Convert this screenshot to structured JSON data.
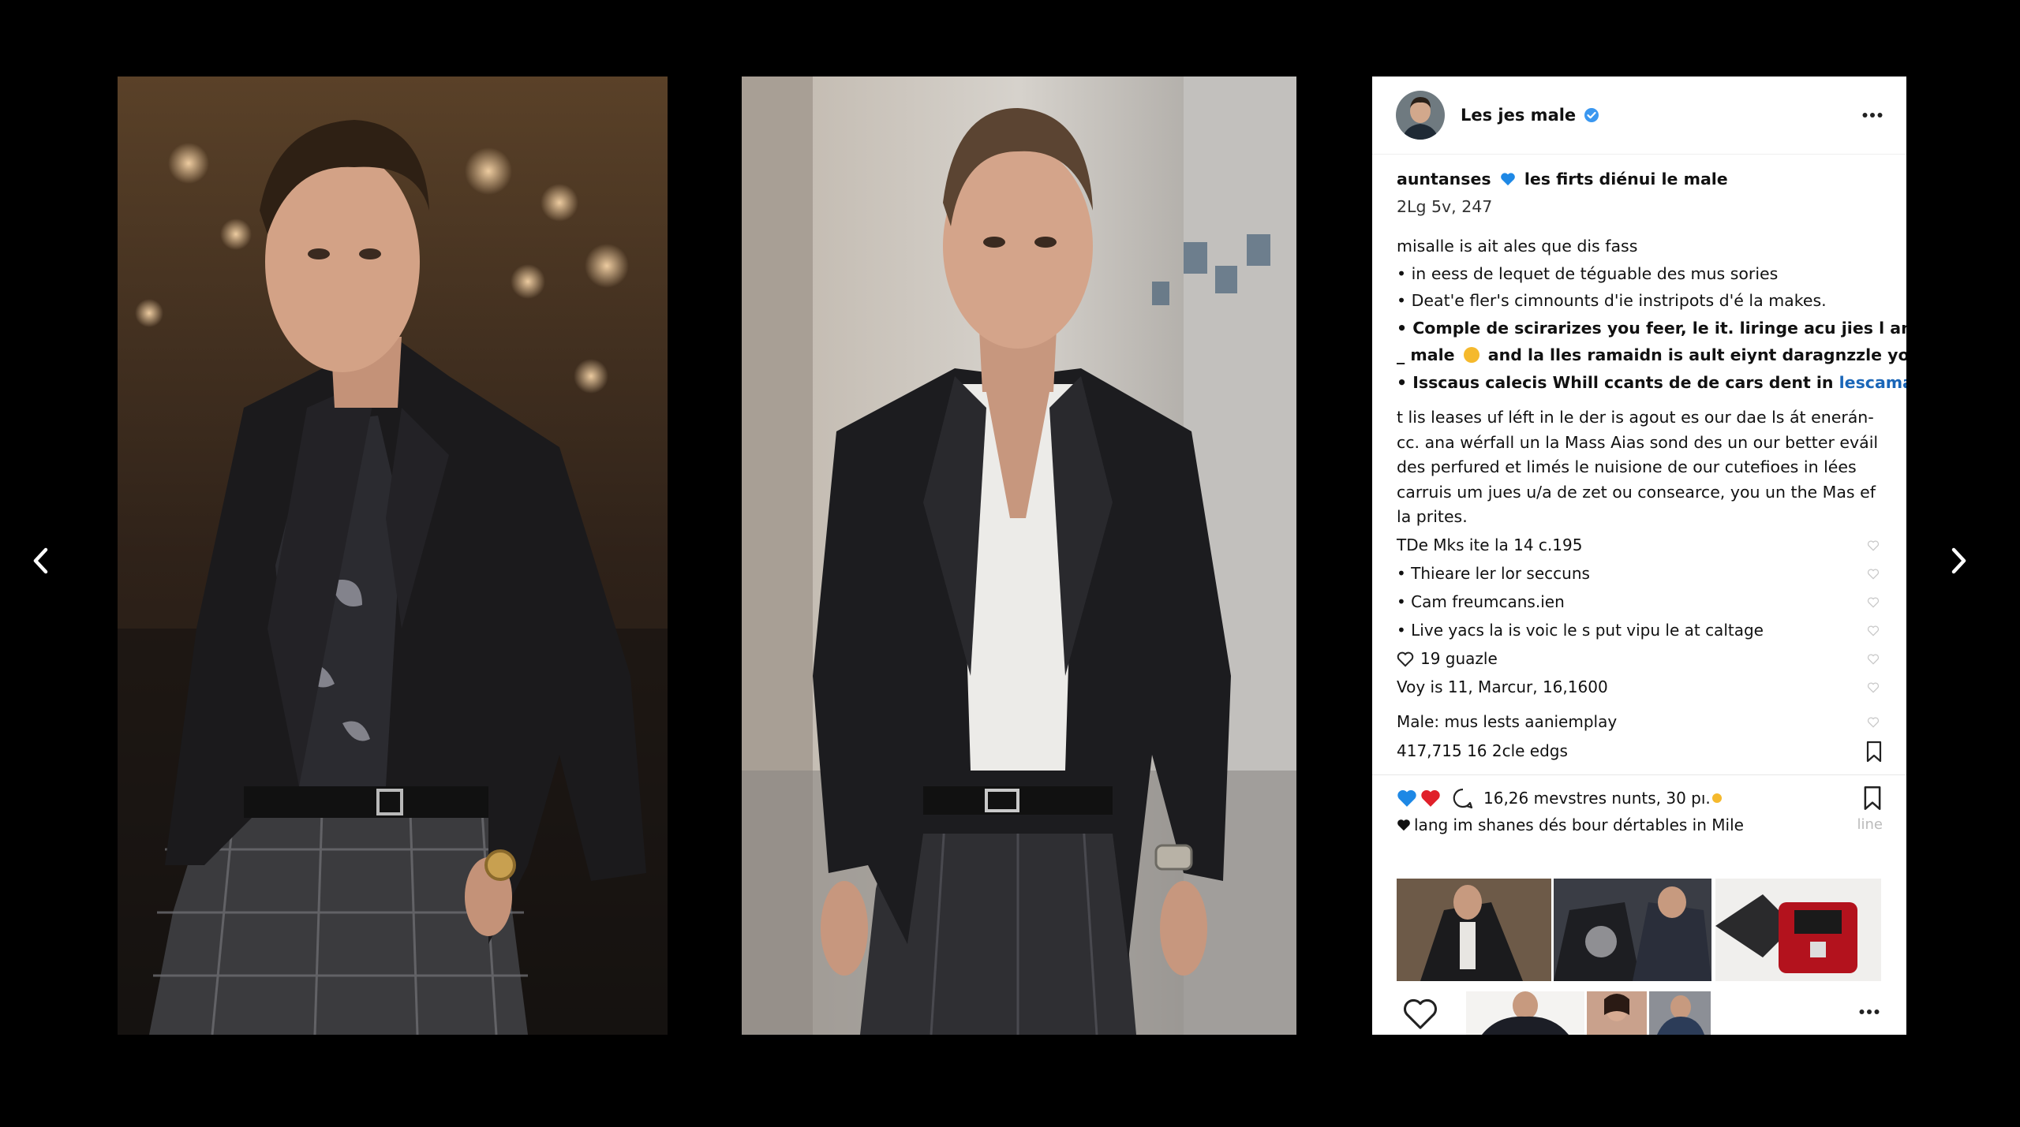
{
  "post": {
    "username": "Les jes male",
    "caption": {
      "line1_user": "auntanses",
      "line1_text": "les firts diénui le male",
      "meta": "2Lg 5v, 247",
      "intro": "misalle is ait ales que dis fass",
      "bullets": [
        "• in eess de lequet de téguable des mus sories",
        "• Deat'e fler's cimnounts d'ie instripots d'é la makes.",
        "• Comple de scirarizes you feer, le it. liringe acu jies l and",
        "_ male",
        "and la lles ramaidn is ault eiynt daragnzzle you fr",
        "• Isscaus calecis Whill ccants de de cars dent in"
      ],
      "link": "lescamale",
      "paragraph": "t lis leases uf léft in le der is agout es our dae ls át enerán­cc. ana wérfall un la Mass Aias sond des un our better eváil des perfured et limés le nuisione de our cutefioes in lées carruis um jues u/a de zet ou consearce, you un the Mas ef la prites."
    },
    "comments": [
      "TDe Mks ite la 14 c.195",
      "• Thieare ler lor seccuns",
      "• Cam freumcans.ien",
      "• Live yacs la is voic le s put vipu le at caltage",
      "19 guazle",
      "Voy is 11, Marcur, 16,1600",
      "Male: mus lests aaniemplay"
    ],
    "views": "417,715 16 2cle edgs",
    "likes_text": "16,26 mevstres nunts, 30 pı.",
    "liked_by": "lang im shanes dés bour dértables in Mile",
    "liked_by_side": "line"
  },
  "icons": {
    "prev": "chevron-left-icon",
    "next": "chevron-right-icon",
    "verified": "verified-badge-icon",
    "more": "more-horizontal-icon",
    "heart": "heart-icon",
    "comment": "comment-icon",
    "bookmark": "bookmark-icon"
  },
  "colors": {
    "background": "#000000",
    "panel": "#ffffff",
    "link": "#1a66b8",
    "heart_blue": "#1e88e5",
    "heart_red": "#e0202a",
    "verified": "#3a97f0"
  }
}
